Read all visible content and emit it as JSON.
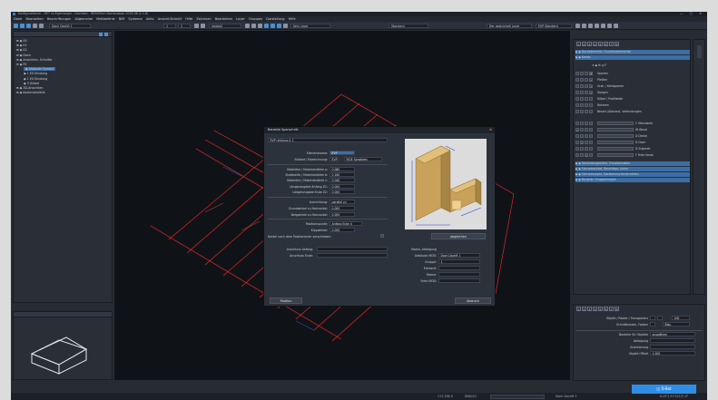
{
  "app": {
    "title": "Konfigurationen - HE7 vs Eigenweger - Dachdan - IRCM/Ohm Dachausbau 2019-08 (1.1.8)",
    "window_controls": "— ▢ ✕"
  },
  "menu": [
    "Datei",
    "Bearbeiten",
    "Beschriftungen",
    "Allgemeine",
    "Meßbefehle",
    "BIM",
    "Systeme",
    "Aktiv",
    "Ansicht/Schnitt",
    "Hilfe",
    "Zeichnen",
    "Bearbeiten",
    "Layer",
    "Gruppen",
    "Darstellung",
    "Hilfe"
  ],
  "toolbar": {
    "roof_select": "Dach Dachft 1",
    "scale": "1",
    "scale2": "1",
    "view_select": "(global)",
    "layer_select": "Kein Layer",
    "standard": "Standard",
    "layer_global": "Der gestrichelt Layer",
    "eo_standard": "EVP Standard"
  },
  "left_tree": [
    {
      "label": "00",
      "level": 0
    },
    {
      "label": "01",
      "level": 0
    },
    {
      "label": "02",
      "level": 0
    },
    {
      "label": "Dach",
      "level": 0
    },
    {
      "label": "Ansichten, Schnitte",
      "level": 0
    },
    {
      "label": "FK",
      "level": 0
    },
    {
      "label": "Stabsatz Symbol",
      "level": 1,
      "selected": true
    },
    {
      "label": "1 EG Bindung",
      "level": 1
    },
    {
      "label": "1 EG Bindung",
      "level": 1
    },
    {
      "label": "3 Giebel",
      "level": 1
    },
    {
      "label": "3D-Ansichten",
      "level": 0
    },
    {
      "label": "Kostenstatistik",
      "level": 0
    }
  ],
  "dialog": {
    "title": "Bauteile Sparschritt",
    "close": "✕",
    "profile_select": "EVP richtung 4_1",
    "fields": {
      "elementname_label": "Elementname:",
      "elementname_value": "EVP",
      "bauteil_label": "Stabart / Bezeichnung:",
      "bauteil_value": "EVP",
      "bauteil_option": "ISGE Sonstiges",
      "dicke_label": "Stabhöhe / Materialstärke a:",
      "dicke_value": "0,080",
      "breite_label": "Stabbreite / Materialstärke b:",
      "breite_value": "0,160",
      "hoehe_label": "Stabhöhe / Materialstärke c:",
      "hoehe_value": "0,040",
      "ueb_anf_label": "Längenzugabe Anfang Z1:",
      "ueb_anf_value": "0,000",
      "ueb_end_label": "Längenzugabe Ende Z2:",
      "ueb_end_value": "0,000",
      "ausrichtung_label": "Ausrichtung:",
      "ausrichtung_value": "parallel zu",
      "grund_label": "Grundwinkel zu Horizontal:",
      "grund_value": "0,000",
      "neig_label": "Neigwinkel zu Horizontal:",
      "neig_value": "0,000",
      "pos_label": "Positionspunkt:",
      "pos_value": "Anfang Ecke 4",
      "kipp_label": "Kippwinkel:",
      "kipp_value": "0,000",
      "kantel_label": "Kantel nach dem Positionieren verschieben:",
      "absenden": "abgleichen",
      "anschl_anf_label": "Anschluss Anfang:",
      "anschl_end_label": "Anschluss Ende:",
      "modul_label": "Modul, Abfolgung",
      "gebaeude_label": "Gebäude MOD:",
      "gebaeude_value": "Dach Dachft 1",
      "gruppe_label": "Gruppe:",
      "gruppe_value": "1",
      "element_label": "Element:",
      "ebene_label": "Ebene:",
      "frei_label": "Freie MOD:"
    },
    "position_btn": "Position",
    "cancel_btn": "Abbruch"
  },
  "right_panel": {
    "tabs": [
      "1",
      "2",
      "3",
      "4",
      "5",
      "6",
      "7",
      "8"
    ],
    "rows_top": [
      "Dachelemente, Grundrisselemente",
      "Konstr."
    ],
    "layers": [
      "Sparren",
      "Pfetten",
      "Grat- / Kehlsparren",
      "Zangen",
      "Dübel / Profilleiste",
      "Rahmen",
      "Beschl./Abbrand, Verbindungen"
    ],
    "layers2": [
      "C Stockwerk",
      "W Wand",
      "D Decke",
      "D Dach",
      "D Zubereit",
      "F Freie Konst."
    ],
    "rows_bottom": [
      "Verbindungsmittel, Transformation",
      "Schraubwinkel, Beschläge, Anker",
      "Schraubungen, Darstellung Konstruktion",
      "Bauteile, Gruppierungen"
    ]
  },
  "right_bottom": {
    "tabs": [
      "1",
      "2",
      "3",
      "4",
      "5",
      "6",
      "7",
      "8"
    ],
    "opacity_label": "Objekt / Raster / Transparenz",
    "opacity_value": "100",
    "schnitt_label": "Schnittkanten, Farben",
    "schnitt_value": "Blau",
    "basis_label": "Bauteile für Objekte",
    "basis_value": "auswählen",
    "abfolge_label": "Abfolgung",
    "orientierung_label": "Orientierung",
    "offset_label": "Objekt Offset",
    "offset_value": "1.000"
  },
  "status": {
    "coords": "117.356 X",
    "mode": "DIN/CIO",
    "roof": "Dach Dachft 1",
    "pos": "0.25°| 51°(22)°| 0°"
  },
  "dbot": "D-Bot",
  "colors": {
    "accent": "#3a7bd5",
    "wire": "#ff2a2a",
    "highlight": "#3c6ea5"
  }
}
